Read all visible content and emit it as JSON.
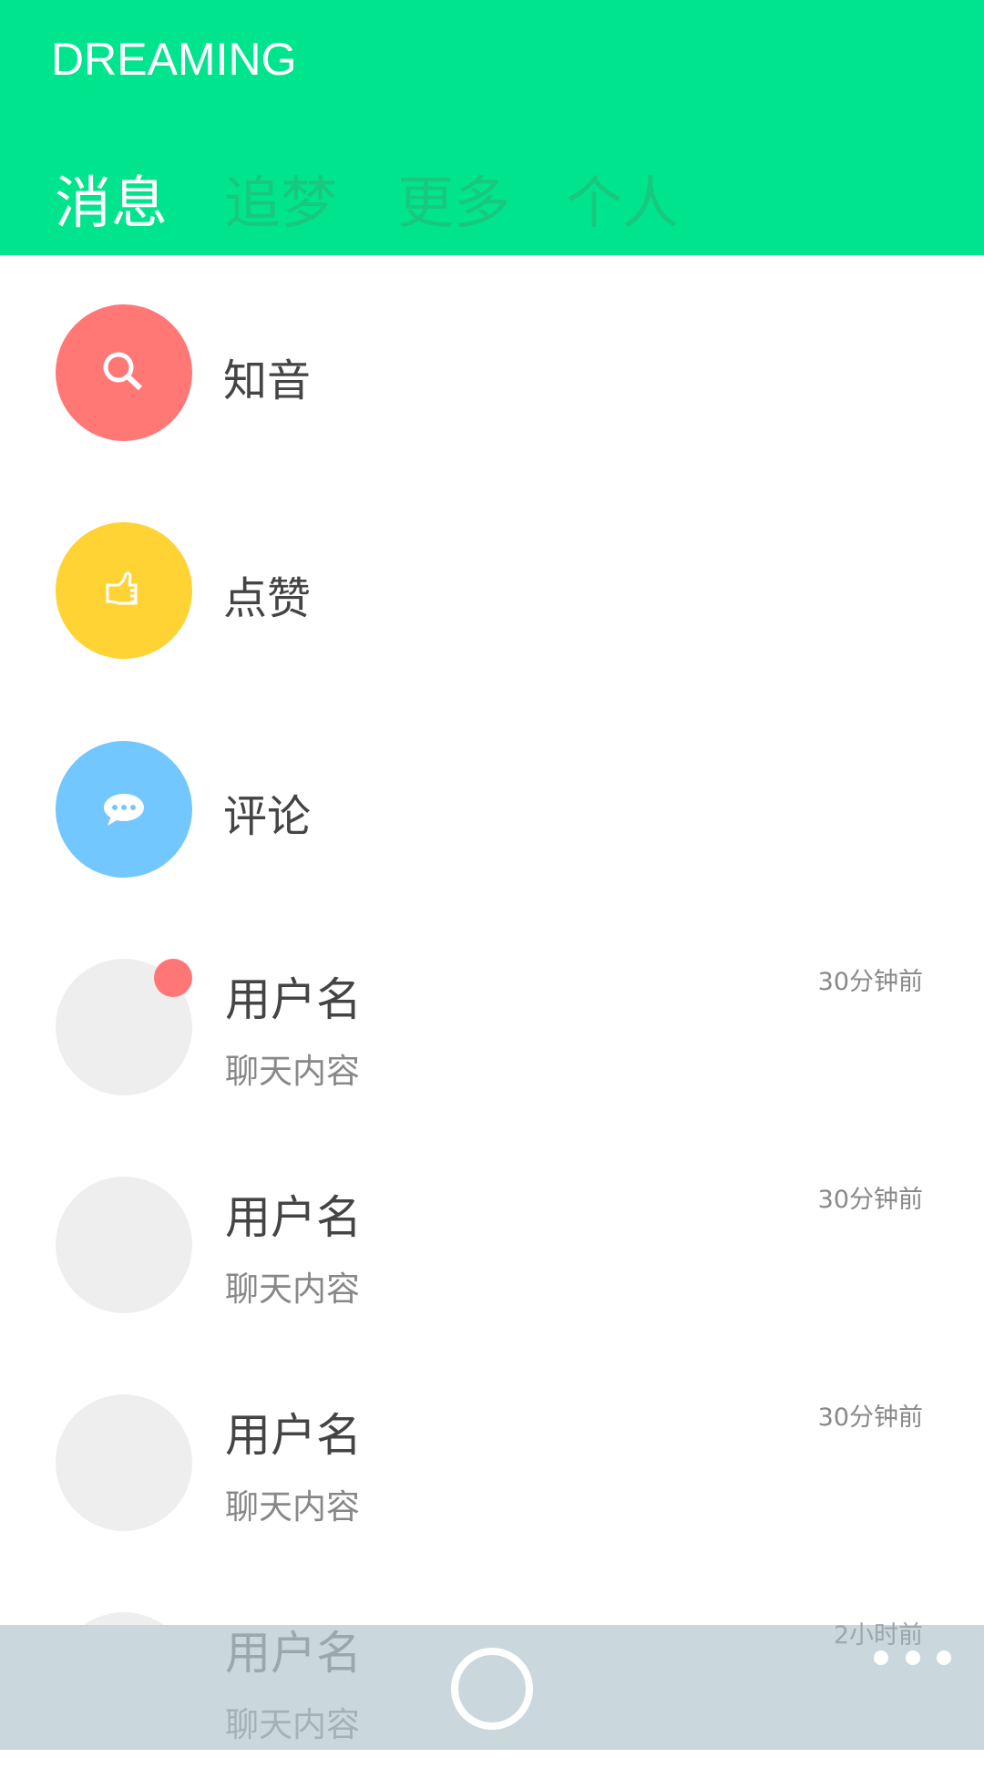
{
  "app": {
    "title": "DREAMING"
  },
  "tabs": [
    {
      "label": "消息"
    },
    {
      "label": "追梦"
    },
    {
      "label": "更多"
    },
    {
      "label": "个人"
    }
  ],
  "categories": [
    {
      "label": "知音",
      "icon": "search-icon",
      "color": "#ff7876"
    },
    {
      "label": "点赞",
      "icon": "thumbs-up-icon",
      "color": "#ffd334"
    },
    {
      "label": "评论",
      "icon": "comment-icon",
      "color": "#72c7ff"
    }
  ],
  "chats": [
    {
      "username": "用户名",
      "message": "聊天内容",
      "time": "30分钟前",
      "unread": true
    },
    {
      "username": "用户名",
      "message": "聊天内容",
      "time": "30分钟前",
      "unread": false
    },
    {
      "username": "用户名",
      "message": "聊天内容",
      "time": "30分钟前",
      "unread": false
    },
    {
      "username": "用户名",
      "message": "聊天内容",
      "time": "2小时前",
      "unread": false
    }
  ]
}
